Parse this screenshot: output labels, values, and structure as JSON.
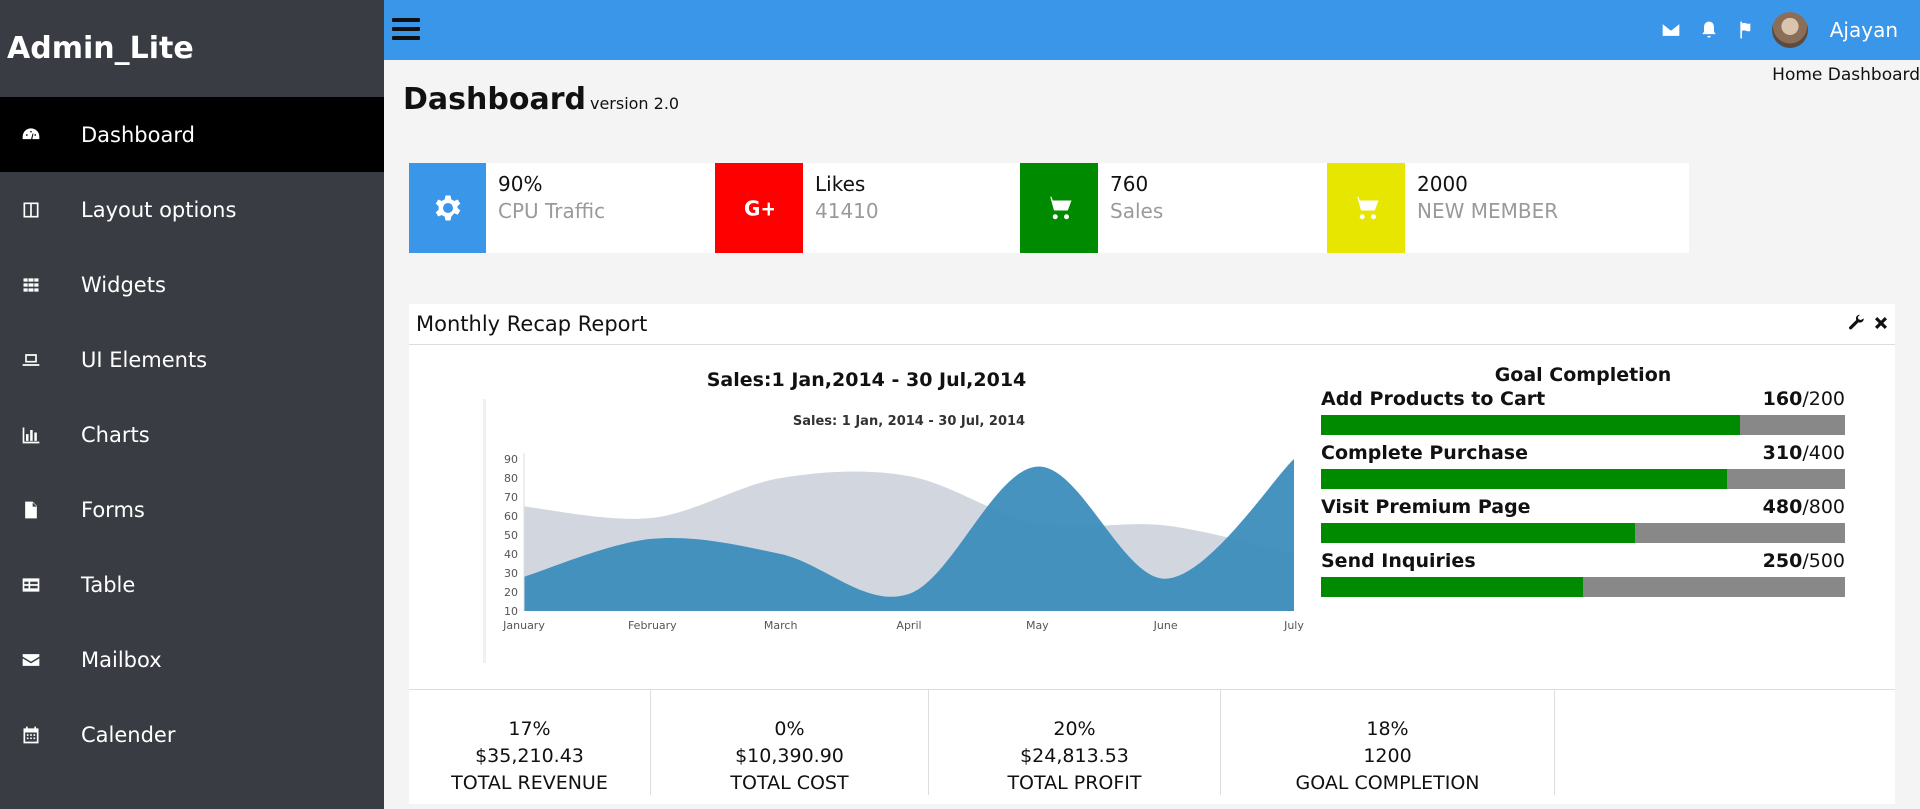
{
  "app": {
    "brand": "Admin_Lite"
  },
  "sidebar": {
    "items": [
      {
        "label": "Dashboard",
        "icon": "dashboard-icon",
        "active": true
      },
      {
        "label": "Layout options",
        "icon": "layout-icon"
      },
      {
        "label": "Widgets",
        "icon": "grid-icon"
      },
      {
        "label": "UI Elements",
        "icon": "laptop-icon"
      },
      {
        "label": "Charts",
        "icon": "bar-chart-icon"
      },
      {
        "label": "Forms",
        "icon": "file-icon"
      },
      {
        "label": "Table",
        "icon": "table-icon"
      },
      {
        "label": "Mailbox",
        "icon": "envelope-icon"
      },
      {
        "label": "Calender",
        "icon": "calendar-icon"
      }
    ]
  },
  "header": {
    "username": "Ajayan",
    "icons": [
      "envelope-icon",
      "bell-icon",
      "flag-icon"
    ]
  },
  "page": {
    "title": "Dashboard",
    "subtitle": "version 2.0",
    "breadcrumb": [
      "Home",
      "Dashboard"
    ]
  },
  "cards": [
    {
      "value": "90%",
      "label": "CPU Traffic",
      "color": "#3a96e9",
      "icon": "gear-icon"
    },
    {
      "value": "Likes",
      "label": "41410",
      "color": "#ff0000",
      "icon": "google-plus-icon"
    },
    {
      "value": "760",
      "label": "Sales",
      "color": "#008a00",
      "icon": "cart-icon"
    },
    {
      "value": "2000",
      "label": "NEW MEMBER",
      "color": "#e6e600",
      "icon": "cart-icon"
    }
  ],
  "report": {
    "title": "Monthly Recap Report",
    "chart_heading": "Sales:1 Jan,2014 - 30 Jul,2014",
    "goal_title": "Goal Completion",
    "goals": [
      {
        "name": "Add Products to Cart",
        "done": "160",
        "total": "/200",
        "fraction": 0.8
      },
      {
        "name": "Complete Purchase",
        "done": "310",
        "total": "/400",
        "fraction": 0.775
      },
      {
        "name": "Visit Premium Page",
        "done": "480",
        "total": "/800",
        "fraction": 0.6
      },
      {
        "name": "Send Inquiries",
        "done": "250",
        "total": "/500",
        "fraction": 0.5
      }
    ],
    "stats": [
      {
        "percent": "17%",
        "amount": "$35,210.43",
        "label": "TOTAL REVENUE"
      },
      {
        "percent": "0%",
        "amount": "$10,390.90",
        "label": "TOTAL COST"
      },
      {
        "percent": "20%",
        "amount": "$24,813.53",
        "label": "TOTAL PROFIT"
      },
      {
        "percent": "18%",
        "amount": "1200",
        "label": "GOAL COMPLETION"
      }
    ]
  },
  "chart_data": {
    "type": "area",
    "title": "Sales: 1 Jan, 2014 - 30 Jul, 2014",
    "categories": [
      "January",
      "February",
      "March",
      "April",
      "May",
      "June",
      "July"
    ],
    "yticks": [
      10,
      20,
      30,
      40,
      50,
      60,
      70,
      80,
      90
    ],
    "ylim": [
      10,
      90
    ],
    "series": [
      {
        "values": [
          65,
          59,
          80,
          81,
          56,
          55,
          40
        ],
        "color": "#d2d6de"
      },
      {
        "values": [
          28,
          48,
          40,
          19,
          86,
          27,
          90
        ],
        "color": "#3c8dbc"
      }
    ],
    "grid": false,
    "legend": "none"
  }
}
